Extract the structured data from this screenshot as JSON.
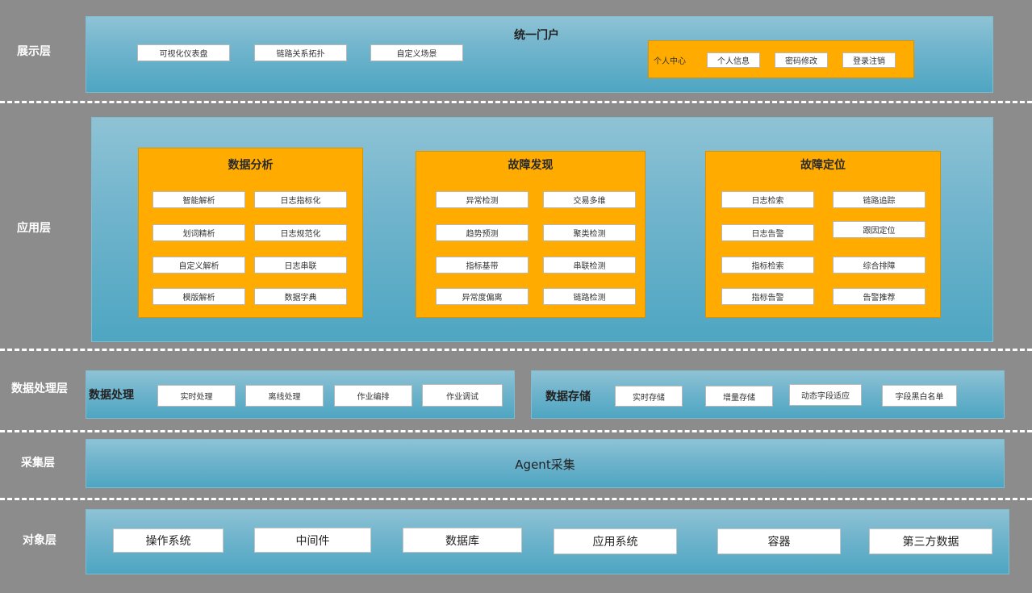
{
  "layers": {
    "presentation": "展示层",
    "application": "应用层",
    "processing": "数据处理层",
    "collection": "采集层",
    "object": "对象层"
  },
  "portal": {
    "title": "统一门户",
    "items": [
      "可视化仪表盘",
      "链路关系拓扑",
      "自定义场景"
    ],
    "personal_center": {
      "label": "个人中心",
      "items": [
        "个人信息",
        "密码修改",
        "登录注销"
      ]
    }
  },
  "application": {
    "modules": [
      {
        "title": "数据分析",
        "items": [
          "智能解析",
          "日志指标化",
          "划词精析",
          "日志规范化",
          "自定义解析",
          "日志串联",
          "模版解析",
          "数据字典"
        ]
      },
      {
        "title": "故障发现",
        "items": [
          "异常检测",
          "交易多维",
          "趋势预测",
          "聚类检测",
          "指标基带",
          "串联检测",
          "异常度偏离",
          "链路检测"
        ]
      },
      {
        "title": "故障定位",
        "items": [
          "日志检索",
          "链路追踪",
          "日志告警",
          "跟因定位",
          "指标检索",
          "综合排障",
          "指标告警",
          "告警推荐"
        ]
      }
    ]
  },
  "processing": {
    "title": "数据处理",
    "items": [
      "实时处理",
      "离线处理",
      "作业编排",
      "作业调试"
    ]
  },
  "storage": {
    "title": "数据存储",
    "items": [
      "实时存储",
      "增量存储",
      "动态字段适应",
      "字段黑白名单"
    ]
  },
  "collection": {
    "agent": "Agent采集"
  },
  "objects": {
    "items": [
      "操作系统",
      "中间件",
      "数据库",
      "应用系统",
      "容器",
      "第三方数据"
    ]
  },
  "colors": {
    "background": "#8c8c8c",
    "panel": "#6fb3cc",
    "module": "#ffab00"
  }
}
